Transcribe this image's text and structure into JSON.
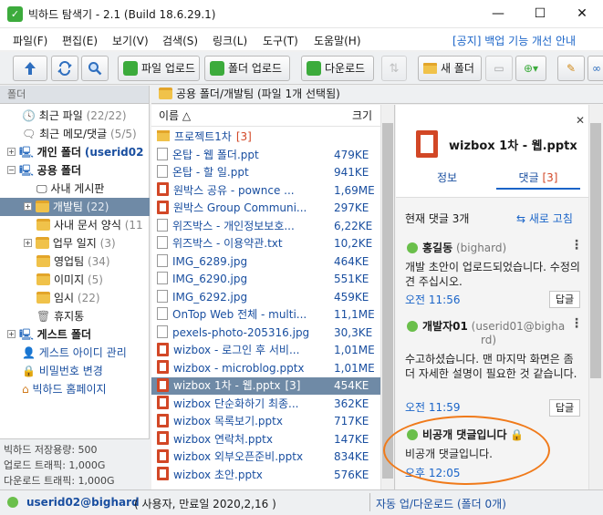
{
  "window": {
    "title": "빅하드 탐색기 - 2.1 (Build 18.6.29.1)",
    "minimize": "—",
    "maximize": "☐",
    "close": "✕"
  },
  "menu": {
    "items": [
      "파일(F)",
      "편집(E)",
      "보기(V)",
      "검색(S)",
      "링크(L)",
      "도구(T)",
      "도움말(H)"
    ],
    "notice": "[공지] 백업 기능 개선 안내"
  },
  "toolbar": {
    "upload_file": "파일 업로드",
    "upload_folder": "폴더 업로드",
    "download": "다운로드",
    "new_folder": "새 폴더"
  },
  "sidebar": {
    "header": "폴더",
    "items": [
      {
        "label": "최근 파일",
        "count": "(22/22)"
      },
      {
        "label": "최근 메모/댓글",
        "count": "(5/5)"
      },
      {
        "label": "개인 폴더",
        "count": "(userid02"
      },
      {
        "label": "공용 폴더",
        "count": ""
      },
      {
        "label": "사내 게시판",
        "count": ""
      },
      {
        "label": "개발팀",
        "count": "(22)"
      },
      {
        "label": "사내 문서 양식",
        "count": "(11"
      },
      {
        "label": "업무 일지",
        "count": "(3)"
      },
      {
        "label": "영업팀",
        "count": "(34)"
      },
      {
        "label": "이미지",
        "count": "(5)"
      },
      {
        "label": "임시",
        "count": "(22)"
      },
      {
        "label": "휴지통",
        "count": ""
      },
      {
        "label": "게스트 폴더",
        "count": ""
      },
      {
        "label": "게스트 아이디 관리",
        "count": ""
      },
      {
        "label": "비밀번호 변경",
        "count": ""
      },
      {
        "label": "빅하드 홈페이지",
        "count": ""
      }
    ],
    "storage": {
      "capacity": "빅하드 저장용량: 500",
      "upload": "업로드    트래픽: 1,000G",
      "download": "다운로드 트래픽: 1,000G"
    }
  },
  "path": {
    "text": "공용 폴더/개발팀 (파일 1개 선택됨)"
  },
  "file_list": {
    "col_name": "이름 △",
    "col_size": "크기",
    "rows": [
      {
        "name": "프로젝트1차",
        "badge": "[3]",
        "size": "",
        "type": "folder"
      },
      {
        "name": "온탑 - 웹 폴더.ppt",
        "badge": "",
        "size": "479KE",
        "type": "doc"
      },
      {
        "name": "온탑 - 할 일.ppt",
        "badge": "",
        "size": "941KE",
        "type": "doc"
      },
      {
        "name": "원박스 공유 - powncе ...",
        "badge": "",
        "size": "1,69ME",
        "type": "ppt"
      },
      {
        "name": "원박스 Group Communi...",
        "badge": "",
        "size": "297KE",
        "type": "ppt"
      },
      {
        "name": "위즈박스 - 개인정보보호...",
        "badge": "",
        "size": "6,22KE",
        "type": "doc"
      },
      {
        "name": "위즈박스 - 이용약관.txt",
        "badge": "",
        "size": "10,2KE",
        "type": "doc"
      },
      {
        "name": "IMG_6289.jpg",
        "badge": "",
        "size": "464KE",
        "type": "doc"
      },
      {
        "name": "IMG_6290.jpg",
        "badge": "",
        "size": "551KE",
        "type": "doc"
      },
      {
        "name": "IMG_6292.jpg",
        "badge": "",
        "size": "459KE",
        "type": "doc"
      },
      {
        "name": "OnTop Web 전체 - multi...",
        "badge": "",
        "size": "11,1ME",
        "type": "doc"
      },
      {
        "name": "pexels-photo-205316.jpg",
        "badge": "",
        "size": "30,3KE",
        "type": "doc"
      },
      {
        "name": "wizbox - 로그인 후 서비...",
        "badge": "",
        "size": "1,01ME",
        "type": "ppt"
      },
      {
        "name": "wizbox - microblog.pptx",
        "badge": "",
        "size": "1,01ME",
        "type": "ppt"
      },
      {
        "name": "wizbox 1차 - 웹.pptx",
        "badge": "[3]",
        "size": "454KE",
        "type": "ppt"
      },
      {
        "name": "wizbox 단순화하기 최종...",
        "badge": "",
        "size": "362KE",
        "type": "ppt"
      },
      {
        "name": "wizbox 목록보기.pptx",
        "badge": "",
        "size": "717KE",
        "type": "ppt"
      },
      {
        "name": "wizbox 연락처.pptx",
        "badge": "",
        "size": "147KE",
        "type": "ppt"
      },
      {
        "name": "wizbox 외부오픈준비.pptx",
        "badge": "",
        "size": "834KE",
        "type": "ppt"
      },
      {
        "name": "wizbox 초안.pptx",
        "badge": "",
        "size": "576KE",
        "type": "ppt"
      }
    ]
  },
  "details": {
    "filename": "wizbox 1차 - 웹.pptx",
    "tab_info": "정보",
    "tab_comments": "댓글",
    "tab_comments_count": "[3]",
    "comment_count": "현재 댓글 3개",
    "refresh": "새로 고침",
    "comments": [
      {
        "author": "홍길동",
        "id": "(bighard)",
        "body": "개발 초안이 업로드되었습니다. 수정의견 주십시오.",
        "time": "오전 11:56",
        "reply": "답글"
      },
      {
        "author": "개발자01",
        "id": "(userid01@bigha",
        "id2": "rd)",
        "body": "수고하셨습니다. 맨 마지막 화면은 좀 더 자세한 설명이 필요한 것 같습니다.",
        "time": "오전 11:59",
        "reply": "답글"
      },
      {
        "author": "비공개 댓글입니다",
        "id": "",
        "body": "비공개 댓글입니다.",
        "time": "오후 12:05",
        "reply": ""
      }
    ]
  },
  "status": {
    "user": "userid02@bighard",
    "user_info": "( 사용자, 만료일 2020,2,16 )",
    "transfer": "자동 업/다운로드 (폴더 0개)"
  },
  "colors": {
    "accent": "#1a64c8",
    "selection": "#6f8aa6",
    "highlight_oval": "#f07a1a",
    "ppt": "#d24726",
    "folder": "#f0c24a"
  }
}
